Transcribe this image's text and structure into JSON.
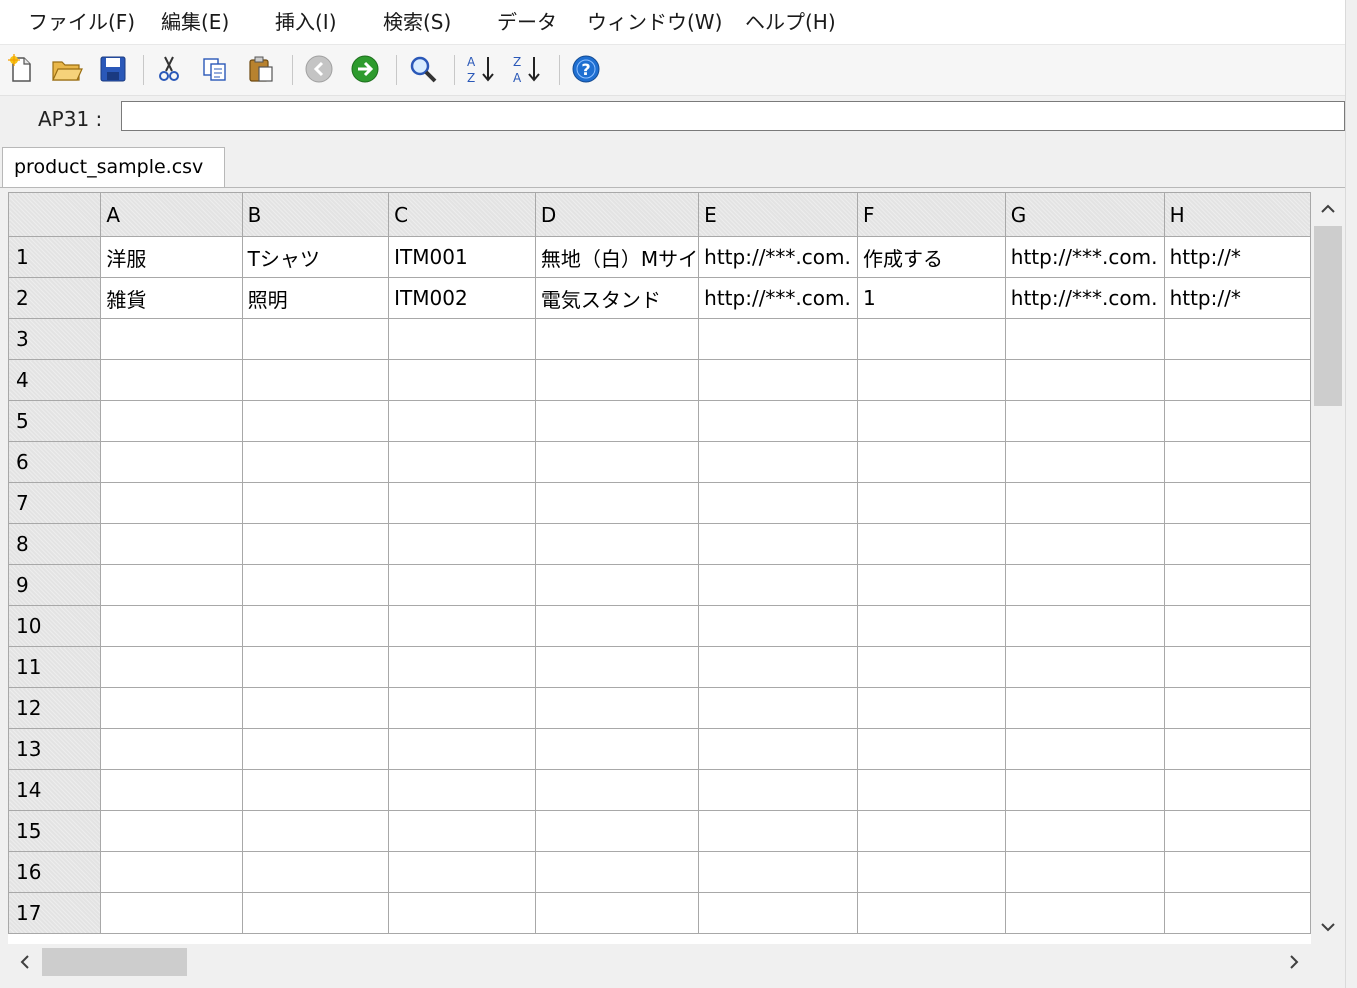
{
  "menu": [
    {
      "label": "ファイル(F)"
    },
    {
      "label": "編集(E)"
    },
    {
      "label": "挿入(I)"
    },
    {
      "label": "検索(S)"
    },
    {
      "label": "データ"
    },
    {
      "label": "ウィンドウ(W)"
    },
    {
      "label": "ヘルプ(H)"
    }
  ],
  "toolbar": {
    "icons": [
      "new-file-icon",
      "open-folder-icon",
      "save-icon",
      "cut-icon",
      "copy-icon",
      "paste-icon",
      "back-icon",
      "forward-icon",
      "search-icon",
      "sort-ascending-icon",
      "sort-descending-icon",
      "help-icon"
    ]
  },
  "address": {
    "label": "AP31 :",
    "value": ""
  },
  "tab": {
    "label": "product_sample.csv"
  },
  "grid": {
    "columns": [
      "A",
      "B",
      "C",
      "D",
      "E",
      "F",
      "G",
      "H"
    ],
    "rows": [
      {
        "num": "1",
        "cells": [
          "洋服",
          "Tシャツ",
          "ITM001",
          "無地（白）Mサイ",
          "http://***.com.",
          "作成する",
          "http://***.com.",
          "http://*"
        ]
      },
      {
        "num": "2",
        "cells": [
          "雑貨",
          "照明",
          "ITM002",
          "電気スタンド",
          "http://***.com.",
          "1",
          "http://***.com.",
          "http://*"
        ]
      },
      {
        "num": "3",
        "cells": [
          "",
          "",
          "",
          "",
          "",
          "",
          "",
          ""
        ]
      },
      {
        "num": "4",
        "cells": [
          "",
          "",
          "",
          "",
          "",
          "",
          "",
          ""
        ]
      },
      {
        "num": "5",
        "cells": [
          "",
          "",
          "",
          "",
          "",
          "",
          "",
          ""
        ]
      },
      {
        "num": "6",
        "cells": [
          "",
          "",
          "",
          "",
          "",
          "",
          "",
          ""
        ]
      },
      {
        "num": "7",
        "cells": [
          "",
          "",
          "",
          "",
          "",
          "",
          "",
          ""
        ]
      },
      {
        "num": "8",
        "cells": [
          "",
          "",
          "",
          "",
          "",
          "",
          "",
          ""
        ]
      },
      {
        "num": "9",
        "cells": [
          "",
          "",
          "",
          "",
          "",
          "",
          "",
          ""
        ]
      },
      {
        "num": "10",
        "cells": [
          "",
          "",
          "",
          "",
          "",
          "",
          "",
          ""
        ]
      },
      {
        "num": "11",
        "cells": [
          "",
          "",
          "",
          "",
          "",
          "",
          "",
          ""
        ]
      },
      {
        "num": "12",
        "cells": [
          "",
          "",
          "",
          "",
          "",
          "",
          "",
          ""
        ]
      },
      {
        "num": "13",
        "cells": [
          "",
          "",
          "",
          "",
          "",
          "",
          "",
          ""
        ]
      },
      {
        "num": "14",
        "cells": [
          "",
          "",
          "",
          "",
          "",
          "",
          "",
          ""
        ]
      },
      {
        "num": "15",
        "cells": [
          "",
          "",
          "",
          "",
          "",
          "",
          "",
          ""
        ]
      },
      {
        "num": "16",
        "cells": [
          "",
          "",
          "",
          "",
          "",
          "",
          "",
          ""
        ]
      },
      {
        "num": "17",
        "cells": [
          "",
          "",
          "",
          "",
          "",
          "",
          "",
          ""
        ]
      }
    ]
  },
  "colors": {
    "header_bg": "#e3e3e3",
    "grid_line": "#a8a8a8",
    "accent_blue": "#1f6fd1",
    "accent_green": "#2e9b2e"
  }
}
